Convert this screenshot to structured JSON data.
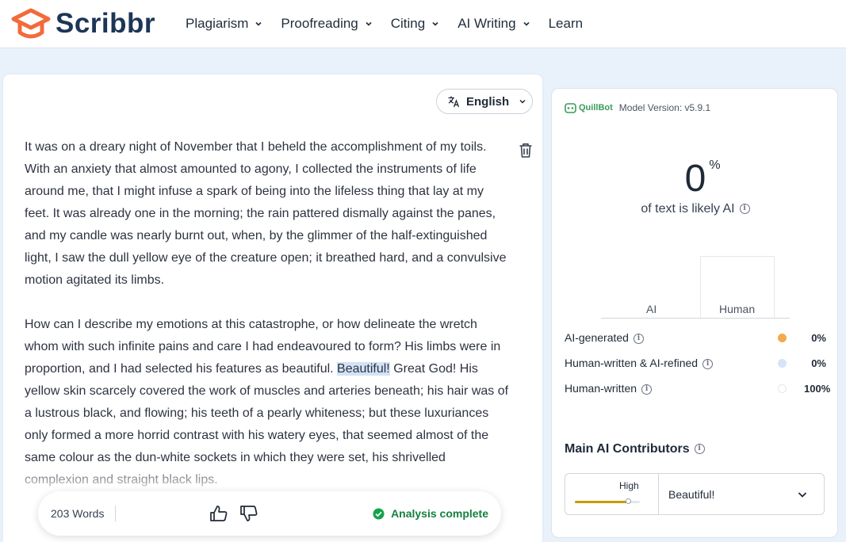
{
  "header": {
    "logo_text": "Scribbr",
    "nav": [
      {
        "label": "Plagiarism",
        "has_dropdown": true
      },
      {
        "label": "Proofreading",
        "has_dropdown": true
      },
      {
        "label": "Citing",
        "has_dropdown": true
      },
      {
        "label": "AI Writing",
        "has_dropdown": true
      },
      {
        "label": "Learn",
        "has_dropdown": false
      }
    ],
    "brand_color": "#f26b3a"
  },
  "editor": {
    "language": "English",
    "paragraph1": "It was on a dreary night of November that I beheld the accomplishment of my toils. With an anxiety that almost amounted to agony, I collected the instruments of life around me, that I might infuse a spark of being into the lifeless thing that lay at my feet. It was already one in the morning; the rain pattered dismally against the panes, and my candle was nearly burnt out, when, by the glimmer of the half-extinguished light, I saw the dull yellow eye of the creature open; it breathed hard, and a convulsive motion agitated its limbs.",
    "paragraph2_before": "How can I describe my emotions at this catastrophe, or how delineate the wretch whom with such infinite pains and care I had endeavoured to form? His limbs were in proportion, and I had selected his features as beautiful. ",
    "paragraph2_highlight": "Beautiful!",
    "paragraph2_after": " Great God! His yellow skin scarcely covered the work of muscles and arteries beneath; his hair was of a lustrous black, and flowing; his teeth of a pearly whiteness; but these luxuriances only formed a more horrid contrast with his watery eyes, that seemed almost of the same colour as the dun-white sockets in which they were set, his shrivelled complexion and straight black lips.",
    "word_count": "203 Words",
    "status": "Analysis complete",
    "highlight_color": "#d3e3f7"
  },
  "results": {
    "provider": "QuillBot",
    "model_version": "Model Version: v5.9.1",
    "ai_percent": "0",
    "percent_sign": "%",
    "caption": "of text is likely AI",
    "chart_categories": [
      "AI",
      "Human"
    ],
    "legend": [
      {
        "label": "AI-generated",
        "value": "0%",
        "color": "#f5a94a"
      },
      {
        "label": "Human-written & AI-refined",
        "value": "0%",
        "color": "#d6e4f7"
      },
      {
        "label": "Human-written",
        "value": "100%",
        "color": "#ffffff"
      }
    ],
    "contributors_title": "Main AI Contributors",
    "contributor": {
      "level": "High",
      "level_fraction": 0.82,
      "text": "Beautiful!"
    }
  }
}
